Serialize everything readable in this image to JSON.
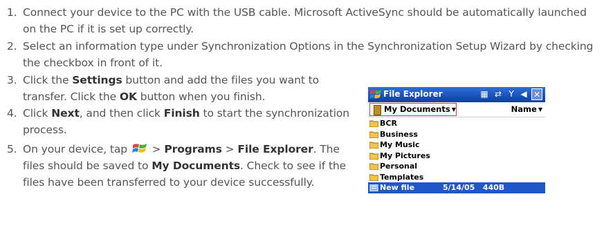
{
  "steps": [
    {
      "num": "1.",
      "text": "Connect your device to the PC with the USB cable. Microsoft ActiveSync should be automatically launched on the PC if it is set up correctly."
    },
    {
      "num": "2.",
      "text": "Select an information type under Synchronization Options in the Synchronization Setup Wizard by checking the checkbox in front of it."
    },
    {
      "num": "3.",
      "p1": "Click the ",
      "b1": "Settings",
      "p2": " button and add the files you want to transfer. Click the ",
      "b2": "OK",
      "p3": " button when you finish."
    },
    {
      "num": "4.",
      "p1": "Click ",
      "b1": "Next",
      "p2": ", and then click ",
      "b2": "Finish",
      "p3": " to start the synchronization process."
    },
    {
      "num": "5.",
      "p1": "On your device, tap ",
      "p2": " > ",
      "b1": "Programs",
      "p3": " > ",
      "b2": "File Explorer",
      "p4": ". The files should be saved to ",
      "b3": "My Documents",
      "p5": ". Check to see if the files have been transferred to your device successfully."
    }
  ],
  "pda": {
    "title": "File Explorer",
    "folder": "My Documents",
    "sort": "Name",
    "files": [
      "BCR",
      "Business",
      "My Music",
      "My Pictures",
      "Personal",
      "Templates"
    ],
    "selected": {
      "name": "New file",
      "date": "5/14/05",
      "size": "440B"
    }
  },
  "icons": {
    "start": "windows-flag-icon",
    "folder": "folder-icon"
  }
}
